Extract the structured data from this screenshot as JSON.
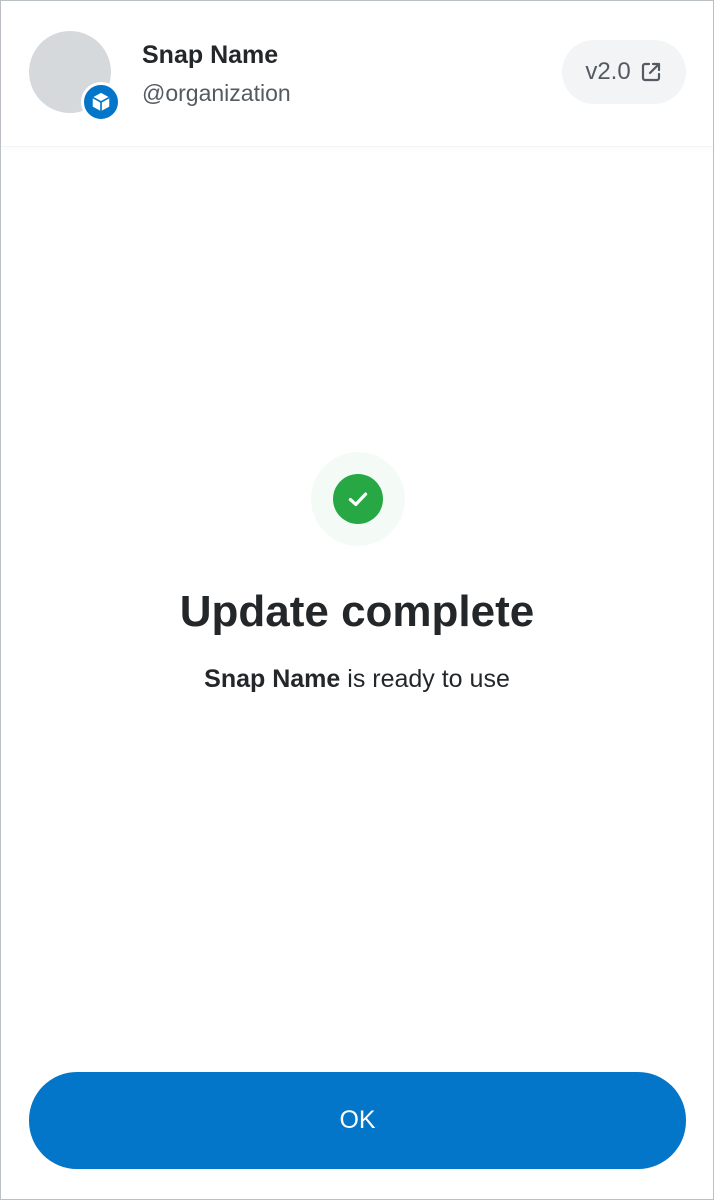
{
  "header": {
    "snap_name": "Snap Name",
    "organization": "@organization",
    "version": "v2.0",
    "avatar_icon": "snap-placeholder-avatar",
    "badge_icon": "box-icon",
    "version_icon": "external-link-icon"
  },
  "result": {
    "icon": "check-circle-icon",
    "title": "Update complete",
    "message_snap_name": "Snap Name",
    "message_suffix": " is ready to use"
  },
  "footer": {
    "ok_label": "OK"
  },
  "colors": {
    "primary": "#0376c9",
    "success": "#28a745",
    "text_default": "#24272a",
    "text_alternative": "#535a61",
    "background_alternative": "#f2f4f6"
  }
}
